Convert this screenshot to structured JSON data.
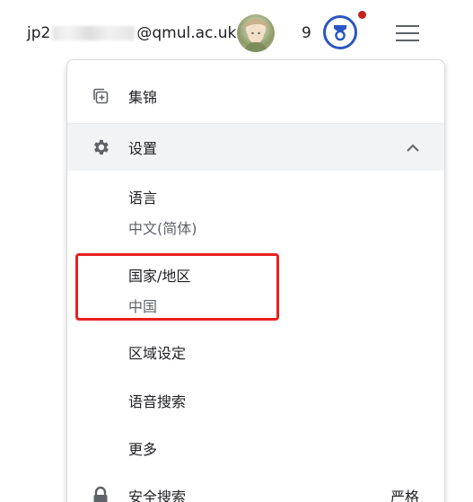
{
  "account": {
    "email_prefix": "jp2",
    "email_suffix": "@qmul.ac.uk",
    "badge_count": "9"
  },
  "menu": {
    "collections_label": "集锦",
    "settings_label": "设置",
    "language_title": "语言",
    "language_value": "中文(简体)",
    "region_title": "国家/地区",
    "region_value": "中国",
    "region_settings_label": "区域设定",
    "voice_search_label": "语音搜索",
    "more_label": "更多",
    "safe_search_label": "安全搜索",
    "safe_search_value": "严格"
  },
  "colors": {
    "accent_blue": "#2a56c6",
    "notification_red": "#c5221f",
    "highlight_red": "#e8201f"
  },
  "icons": [
    "avatar",
    "trophy-icon",
    "hamburger-menu-icon",
    "collections-icon",
    "gear-icon",
    "chevron-up-icon",
    "lock-icon"
  ]
}
